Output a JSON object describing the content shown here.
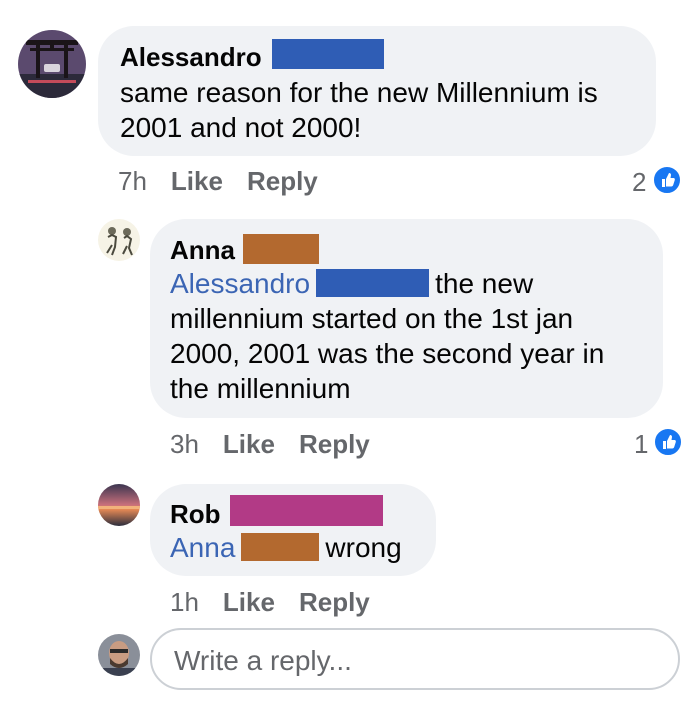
{
  "comments": [
    {
      "author": "Alessandro",
      "text": "same reason for the new Millennium is 2001 and not 2000!",
      "time": "7h",
      "like_label": "Like",
      "reply_label": "Reply",
      "reaction_count": "2",
      "redaction_color": "#2f5db5"
    },
    {
      "author": "Anna",
      "mention": "Alessandro",
      "text_after_mention": "the new millennium started on the 1st jan 2000, 2001 was the second year in the millennium",
      "time": "3h",
      "like_label": "Like",
      "reply_label": "Reply",
      "reaction_count": "1",
      "redaction_color": "#b3692f",
      "mention_redaction_color": "#2f5db5"
    },
    {
      "author": "Rob",
      "mention": "Anna",
      "text_after_mention": "wrong",
      "time": "1h",
      "like_label": "Like",
      "reply_label": "Reply",
      "redaction_color": "#b23a86",
      "mention_redaction_color": "#b3692f"
    }
  ],
  "reply_box": {
    "placeholder": "Write a reply..."
  },
  "colors": {
    "like_blue": "#1877f2",
    "mention_blue": "#3b65b4",
    "bubble_bg": "#f0f2f5"
  }
}
